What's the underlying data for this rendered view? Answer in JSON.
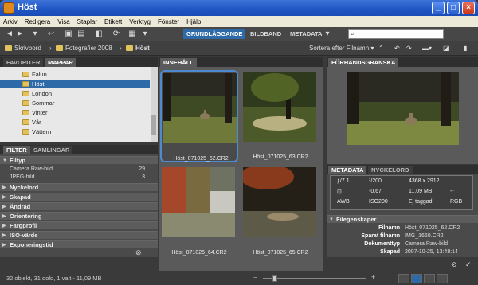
{
  "window": {
    "title": "Höst"
  },
  "menu": [
    "Arkiv",
    "Redigera",
    "Visa",
    "Staplar",
    "Etikett",
    "Verktyg",
    "Fönster",
    "Hjälp"
  ],
  "toolbar": {
    "workspaces": [
      "GRUNDLÄGGANDE",
      "BILDBAND",
      "METADATA"
    ],
    "active_workspace": "GRUNDLÄGGANDE",
    "search_placeholder": "",
    "accent": "#2e6aa8"
  },
  "pathbar": {
    "crumbs": [
      "Skrivbord",
      "Fotografier 2008",
      "Höst"
    ],
    "sort_label": "Sortera efter Filnamn"
  },
  "left_top": {
    "tabs": [
      "FAVORITER",
      "MAPPAR"
    ],
    "active_tab": "MAPPAR",
    "folders": [
      "Falun",
      "Höst",
      "London",
      "Sommar",
      "Vinter",
      "Vår",
      "Vättern"
    ],
    "selected_folder": "Höst"
  },
  "filter": {
    "tabs": [
      "FILTER",
      "SAMLINGAR"
    ],
    "active_tab": "FILTER",
    "filtyp_label": "Filtyp",
    "items": [
      {
        "label": "Camera Raw-bild",
        "count": "29"
      },
      {
        "label": "JPEG-bild",
        "count": "3"
      }
    ],
    "categories": [
      "Nyckelord",
      "Skapad",
      "Ändrad",
      "Orientering",
      "Färgprofil",
      "ISO-värde",
      "Exponeringstid"
    ]
  },
  "content": {
    "tab": "INNEHÅLL",
    "thumbs": [
      "Höst_071025_62.CR2",
      "Höst_071025_63.CR2",
      "Höst_071025_64.CR2",
      "Höst_071025_65.CR2"
    ],
    "selected_thumb": "Höst_071025_62.CR2"
  },
  "preview": {
    "tab": "FÖRHANDSGRANSKA"
  },
  "metadata": {
    "tabs": [
      "METADATA",
      "NYCKELORD"
    ],
    "active_tab": "METADATA",
    "aperture_prefix": "ƒ",
    "aperture": "/7.1",
    "shutter": "¹/200",
    "ev": "-0,67",
    "iso": "ISO200",
    "wb": "AWB",
    "dimensions": "4368 x 2912",
    "size": "11,09 MB",
    "dpi": "--",
    "tag": "Ej taggad",
    "color": "RGB",
    "section_title": "Filegenskaper",
    "fields": [
      {
        "label": "Filnamn",
        "value": "Höst_071025_62.CR2"
      },
      {
        "label": "Sparat filnamn",
        "value": "IMG_1660.CR2"
      },
      {
        "label": "Dokumenttyp",
        "value": "Camera Raw-bild"
      },
      {
        "label": "Skapad",
        "value": "2007-10-25, 13:48:14"
      }
    ]
  },
  "status": {
    "text": "32 objekt, 31 dold, 1 valt - 11,09 MB",
    "zoom": 0.1
  }
}
